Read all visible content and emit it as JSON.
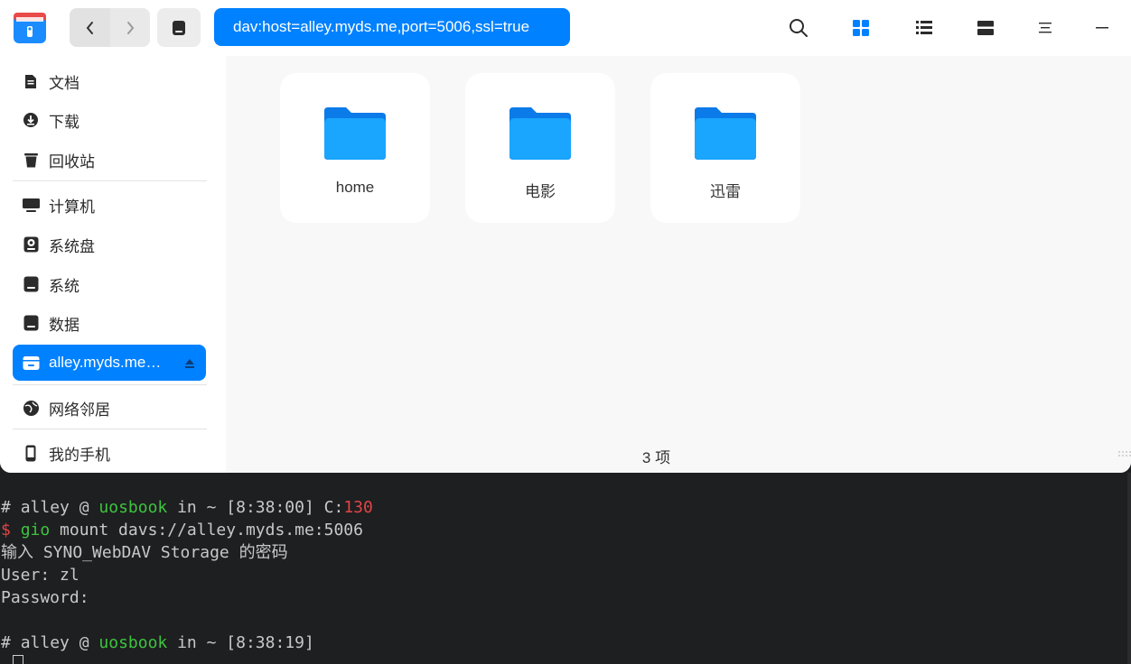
{
  "window": {
    "address": "dav:host=alley.myds.me,port=5006,ssl=true",
    "accent": "#0081ff"
  },
  "toolbar": {
    "back_icon": "chevron-left-icon",
    "forward_icon": "chevron-right-icon",
    "root_icon": "drive-icon",
    "search_icon": "search-icon",
    "icon_view_icon": "grid-view-icon",
    "list_view_icon": "list-view-icon",
    "detail_view_icon": "detail-view-icon",
    "menu_icon": "menu-icon",
    "minimize_icon": "minimize-icon"
  },
  "sidebar": {
    "items": [
      {
        "label": "文档",
        "icon": "document-icon"
      },
      {
        "label": "下载",
        "icon": "download-icon"
      },
      {
        "label": "回收站",
        "icon": "trash-icon"
      },
      {
        "label": "计算机",
        "icon": "computer-icon"
      },
      {
        "label": "系统盘",
        "icon": "system-disk-icon"
      },
      {
        "label": "系统",
        "icon": "disk-icon"
      },
      {
        "label": "数据",
        "icon": "disk-icon"
      },
      {
        "label": "alley.myds.me…",
        "icon": "network-drive-icon",
        "active": true
      },
      {
        "label": "网络邻居",
        "icon": "network-icon"
      },
      {
        "label": "我的手机",
        "icon": "phone-icon"
      }
    ]
  },
  "content": {
    "folders": [
      {
        "name": "home"
      },
      {
        "name": "电影"
      },
      {
        "name": "迅雷"
      }
    ],
    "status": "3 项"
  },
  "terminal": {
    "line1": {
      "hash": "# ",
      "user": "alley",
      "at": " @ ",
      "host": "uosbook",
      "in": " in ",
      "path": "~",
      "time": " [8:38:00] C:",
      "code": "130"
    },
    "line2": {
      "prompt": "$ ",
      "cmd": "gio",
      "args": " mount davs://alley.myds.me:5006"
    },
    "line3": "输入 SYNO_WebDAV Storage 的密码",
    "line4": "User: zl",
    "line5": "Password:",
    "line6": {
      "hash": "# ",
      "user": "alley",
      "at": " @ ",
      "host": "uosbook",
      "in": " in ",
      "path": "~",
      "time": " [8:38:19]"
    }
  }
}
